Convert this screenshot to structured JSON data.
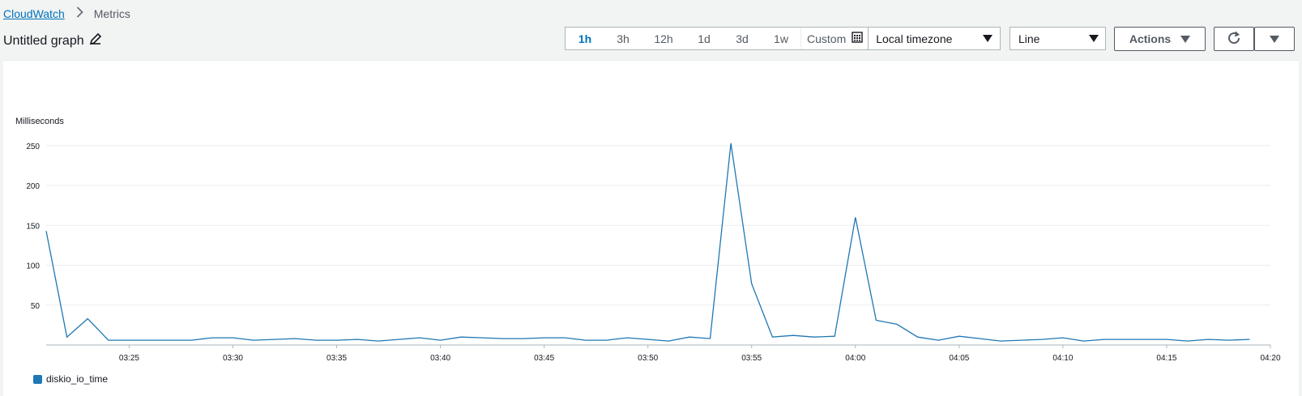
{
  "breadcrumb": {
    "link": "CloudWatch",
    "current": "Metrics"
  },
  "title": "Untitled graph",
  "time_ranges": [
    "1h",
    "3h",
    "12h",
    "1d",
    "3d",
    "1w"
  ],
  "active_range": "1h",
  "custom_label": "Custom",
  "timezone": "Local timezone",
  "view_type": "Line",
  "actions_label": "Actions",
  "icons": {
    "edit": "pencil-icon",
    "calendar": "calendar-icon",
    "refresh": "refresh-icon",
    "caret": "caret-down-icon"
  },
  "colors": {
    "series": "#1f77b4",
    "link": "#0073bb"
  },
  "chart_data": {
    "type": "line",
    "ylabel": "Milliseconds",
    "ylim": [
      0,
      262
    ],
    "yticks": [
      50,
      100,
      150,
      200,
      250
    ],
    "xtick_labels": [
      "03:25",
      "03:30",
      "03:35",
      "03:40",
      "03:45",
      "03:50",
      "03:55",
      "04:00",
      "04:05",
      "04:10",
      "04:15",
      "04:20"
    ],
    "x_start": "03:21",
    "x_end": "04:20",
    "grid": true,
    "legend_position": "bottom-left",
    "series": [
      {
        "name": "diskio_io_time",
        "color": "#1f77b4",
        "x": [
          "03:21",
          "03:22",
          "03:23",
          "03:24",
          "03:25",
          "03:26",
          "03:27",
          "03:28",
          "03:29",
          "03:30",
          "03:31",
          "03:32",
          "03:33",
          "03:34",
          "03:35",
          "03:36",
          "03:37",
          "03:38",
          "03:39",
          "03:40",
          "03:41",
          "03:42",
          "03:43",
          "03:44",
          "03:45",
          "03:46",
          "03:47",
          "03:48",
          "03:49",
          "03:50",
          "03:51",
          "03:52",
          "03:53",
          "03:54",
          "03:55",
          "03:56",
          "03:57",
          "03:58",
          "03:59",
          "04:00",
          "04:01",
          "04:02",
          "04:03",
          "04:04",
          "04:05",
          "04:06",
          "04:07",
          "04:08",
          "04:09",
          "04:10",
          "04:11",
          "04:12",
          "04:13",
          "04:14",
          "04:15",
          "04:16",
          "04:17",
          "04:18",
          "04:19"
        ],
        "values": [
          143,
          10,
          33,
          6,
          6,
          6,
          6,
          6,
          9,
          9,
          6,
          7,
          8,
          6,
          6,
          7,
          5,
          7,
          9,
          6,
          10,
          9,
          8,
          8,
          9,
          9,
          6,
          6,
          9,
          7,
          5,
          10,
          8,
          253,
          77,
          10,
          12,
          10,
          11,
          160,
          31,
          26,
          10,
          6,
          11,
          8,
          5,
          6,
          7,
          9,
          5,
          7,
          7,
          7,
          7,
          5,
          7,
          6,
          7
        ]
      }
    ]
  }
}
